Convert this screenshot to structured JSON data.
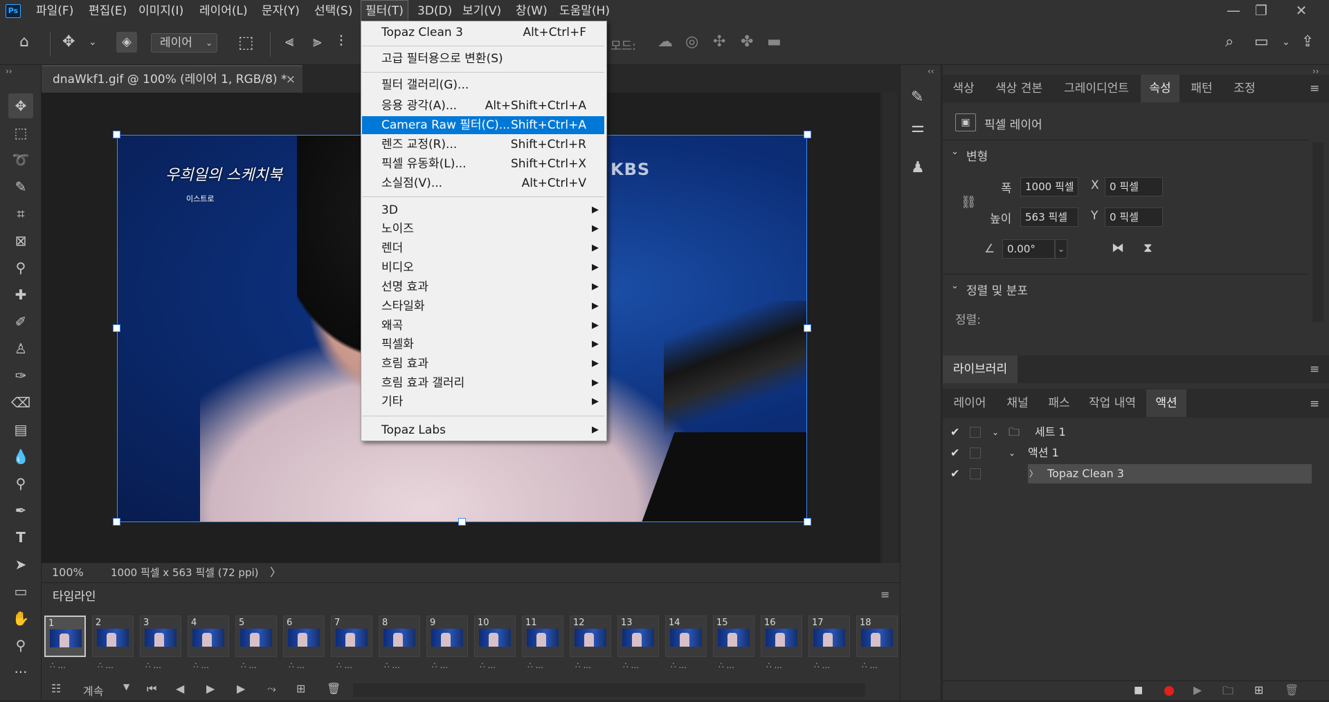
{
  "app": {
    "logo": "Ps"
  },
  "menubar": {
    "items": [
      "파일(F)",
      "편집(E)",
      "이미지(I)",
      "레이어(L)",
      "문자(Y)",
      "선택(S)",
      "필터(T)",
      "3D(D)",
      "보기(V)",
      "창(W)",
      "도움말(H)"
    ],
    "active_index": 6
  },
  "window_controls": {
    "minimize": "—",
    "restore": "❐",
    "close": "✕"
  },
  "options": {
    "layer_select": "레이어",
    "mode_label": "모드:"
  },
  "document": {
    "tab_title": "dnaWkf1.gif @ 100% (레이어 1, RGB/8) *",
    "close": "×"
  },
  "image": {
    "logo_text": "우희일의 스케치북",
    "logo_sub": "이스트로",
    "kbs_logo": "KBS"
  },
  "status": {
    "zoom": "100%",
    "dimensions": "1000 픽셀 x 563 픽셀 (72 ppi)",
    "arrow": "〉"
  },
  "timeline": {
    "title": "타임라인",
    "frames": [
      "1",
      "2",
      "3",
      "4",
      "5",
      "6",
      "7",
      "8",
      "9",
      "10",
      "11",
      "12",
      "13",
      "14",
      "15",
      "16",
      "17",
      "18"
    ],
    "selected_frame": 1,
    "frame_delay": "∴ ...",
    "loop_label": "계속"
  },
  "filter_menu": {
    "items": [
      {
        "label": "Topaz Clean 3",
        "shortcut": "Alt+Ctrl+F"
      },
      {
        "label": "고급 필터용으로 변환(S)",
        "shortcut": ""
      },
      {
        "label": "필터 갤러리(G)...",
        "shortcut": ""
      },
      {
        "label": "응용 광각(A)...",
        "shortcut": "Alt+Shift+Ctrl+A"
      },
      {
        "label": "Camera Raw 필터(C)...",
        "shortcut": "Shift+Ctrl+A"
      },
      {
        "label": "렌즈 교정(R)...",
        "shortcut": "Shift+Ctrl+R"
      },
      {
        "label": "픽셀 유동화(L)...",
        "shortcut": "Shift+Ctrl+X"
      },
      {
        "label": "소실점(V)...",
        "shortcut": "Alt+Ctrl+V"
      },
      {
        "label": "3D",
        "shortcut": ""
      },
      {
        "label": "노이즈",
        "shortcut": ""
      },
      {
        "label": "렌더",
        "shortcut": ""
      },
      {
        "label": "비디오",
        "shortcut": ""
      },
      {
        "label": "선명 효과",
        "shortcut": ""
      },
      {
        "label": "스타일화",
        "shortcut": ""
      },
      {
        "label": "왜곡",
        "shortcut": ""
      },
      {
        "label": "픽셀화",
        "shortcut": ""
      },
      {
        "label": "흐림 효과",
        "shortcut": ""
      },
      {
        "label": "흐림 효과 갤러리",
        "shortcut": ""
      },
      {
        "label": "기타",
        "shortcut": ""
      },
      {
        "label": "Topaz Labs",
        "shortcut": ""
      }
    ],
    "highlighted_index": 4
  },
  "properties_panel": {
    "tabs": [
      "색상",
      "색상 견본",
      "그레이디언트",
      "속성",
      "패턴",
      "조정"
    ],
    "active_tab": "속성",
    "layer_type": "픽셀 레이어",
    "transform_title": "변형",
    "width_label": "폭",
    "width_value": "1000 픽셀",
    "height_label": "높이",
    "height_value": "563 픽셀",
    "x_label": "X",
    "x_value": "0 픽셀",
    "y_label": "Y",
    "y_value": "0 픽셀",
    "angle_value": "0.00°",
    "align_title": "정렬 및 분포",
    "align_label": "정렬:"
  },
  "library_panel": {
    "title": "라이브러리"
  },
  "actions_panel": {
    "tabs": [
      "레이어",
      "채널",
      "패스",
      "작업 내역",
      "액션"
    ],
    "active_tab": "액션",
    "rows": [
      {
        "label": "세트 1",
        "level": 0,
        "expanded": true
      },
      {
        "label": "액션 1",
        "level": 1,
        "expanded": true
      },
      {
        "label": "Topaz Clean 3",
        "level": 2,
        "expanded": false
      }
    ]
  },
  "colors": {
    "accent": "#0078d7",
    "selection": "#3a8cff",
    "panel_bg": "#323232",
    "record": "#e0201e"
  }
}
